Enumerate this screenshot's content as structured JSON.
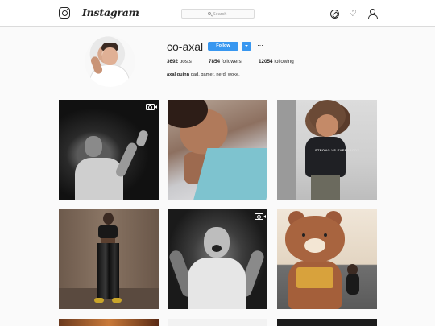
{
  "brand": {
    "wordmark": "Instagram"
  },
  "search": {
    "placeholder": "Search"
  },
  "nav_icons": [
    "compass-icon",
    "heart-icon",
    "user-icon"
  ],
  "profile": {
    "username": "co-axal",
    "follow_label": "Follow",
    "more_label": "···",
    "posts_count": "3692",
    "posts_label": "posts",
    "followers_count": "7854",
    "followers_label": "followers",
    "following_count": "12054",
    "following_label": "following",
    "full_name": "axal quinn",
    "bio": "dad, gamer, nerd, woke."
  },
  "colors": {
    "accent": "#3897f0",
    "background": "#fafafa",
    "text": "#262626",
    "border": "#dbdbdb"
  },
  "posts": [
    {
      "kind": "video",
      "icon": "video-icon"
    },
    {
      "kind": "photo"
    },
    {
      "kind": "photo",
      "shirt_text": "STRONG VS EVERYBODY"
    },
    {
      "kind": "photo"
    },
    {
      "kind": "video",
      "icon": "video-icon"
    },
    {
      "kind": "photo"
    }
  ]
}
